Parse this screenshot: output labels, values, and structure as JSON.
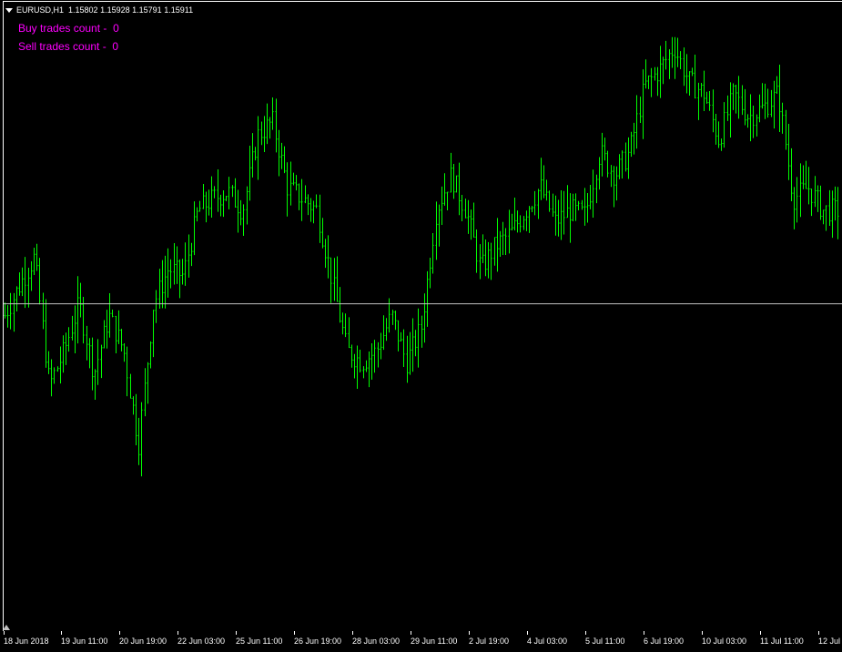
{
  "header": {
    "symbol_timeframe": "EURUSD,H1",
    "open": "1.15802",
    "high": "1.15928",
    "low": "1.15791",
    "close": "1.15911"
  },
  "stats": {
    "buy_label": "Buy trades count -",
    "buy_value": "0",
    "sell_label": "Sell trades count -",
    "sell_value": "0"
  },
  "colors": {
    "background": "#000000",
    "bars": "#00ff00",
    "text": "#ffffff",
    "stats_text": "#ff00ff",
    "grid_line": "#c0c0c0"
  },
  "time_axis": {
    "labels": [
      "18 Jun 2018",
      "19 Jun 11:00",
      "20 Jun 19:00",
      "22 Jun 03:00",
      "25 Jun 11:00",
      "26 Jun 19:00",
      "28 Jun 03:00",
      "29 Jun 11:00",
      "2 Jul 19:00",
      "4 Jul 03:00",
      "5 Jul 11:00",
      "6 Jul 19:00",
      "10 Jul 03:00",
      "11 Jul 11:00",
      "12 Jul"
    ]
  },
  "chart_data": {
    "type": "ohlc",
    "series": [
      {
        "name": "EURUSD,H1",
        "anchors": [
          {
            "t": "18 Jun 2018",
            "close": 1.1595
          },
          {
            "t": "18 Jun 2018 12:00",
            "close": 1.1608
          },
          {
            "t": "19 Jun 02:00",
            "close": 1.162
          },
          {
            "t": "19 Jun 05:00",
            "close": 1.1565
          },
          {
            "t": "19 Jun 11:00",
            "close": 1.158
          },
          {
            "t": "19 Jun 18:00",
            "close": 1.16
          },
          {
            "t": "20 Jun 04:00",
            "close": 1.157
          },
          {
            "t": "20 Jun 12:00",
            "close": 1.1595
          },
          {
            "t": "20 Jun 19:00",
            "close": 1.158
          },
          {
            "t": "21 Jun 05:00",
            "close": 1.154
          },
          {
            "t": "21 Jun 09:00",
            "close": 1.16
          },
          {
            "t": "21 Jun 14:00",
            "close": 1.1615
          },
          {
            "t": "21 Jun 22:00",
            "close": 1.1612
          },
          {
            "t": "22 Jun 03:00",
            "close": 1.164
          },
          {
            "t": "22 Jun 10:00",
            "close": 1.1645
          },
          {
            "t": "22 Jun 17:00",
            "close": 1.1648
          },
          {
            "t": "25 Jun 04:00",
            "close": 1.164
          },
          {
            "t": "25 Jun 11:00",
            "close": 1.1672
          },
          {
            "t": "25 Jun 20:00",
            "close": 1.1678
          },
          {
            "t": "26 Jun 03:00",
            "close": 1.165
          },
          {
            "t": "26 Jun 09:00",
            "close": 1.1645
          },
          {
            "t": "26 Jun 19:00",
            "close": 1.164
          },
          {
            "t": "27 Jun 04:00",
            "close": 1.161
          },
          {
            "t": "27 Jun 09:00",
            "close": 1.158
          },
          {
            "t": "27 Jun 17:00",
            "close": 1.1575
          },
          {
            "t": "28 Jun 03:00",
            "close": 1.158
          },
          {
            "t": "28 Jun 08:00",
            "close": 1.1595
          },
          {
            "t": "28 Jun 13:00",
            "close": 1.1575
          },
          {
            "t": "28 Jun 19:00",
            "close": 1.159
          },
          {
            "t": "29 Jun 02:00",
            "close": 1.164
          },
          {
            "t": "29 Jun 08:00",
            "close": 1.1655
          },
          {
            "t": "29 Jun 14:00",
            "close": 1.164
          },
          {
            "t": "2 Jul 03:00",
            "close": 1.1615
          },
          {
            "t": "2 Jul 09:00",
            "close": 1.1625
          },
          {
            "t": "2 Jul 19:00",
            "close": 1.163
          },
          {
            "t": "3 Jul 06:00",
            "close": 1.164
          },
          {
            "t": "3 Jul 16:00",
            "close": 1.165
          },
          {
            "t": "4 Jul 03:00",
            "close": 1.1635
          },
          {
            "t": "4 Jul 11:00",
            "close": 1.164
          },
          {
            "t": "4 Jul 21:00",
            "close": 1.1638
          },
          {
            "t": "5 Jul 03:00",
            "close": 1.1665
          },
          {
            "t": "5 Jul 11:00",
            "close": 1.1655
          },
          {
            "t": "5 Jul 20:00",
            "close": 1.1665
          },
          {
            "t": "6 Jul 03:00",
            "close": 1.1693
          },
          {
            "t": "6 Jul 12:00",
            "close": 1.17
          },
          {
            "t": "6 Jul 19:00",
            "close": 1.171
          },
          {
            "t": "9 Jul 03:00",
            "close": 1.1695
          },
          {
            "t": "9 Jul 12:00",
            "close": 1.169
          },
          {
            "t": "9 Jul 21:00",
            "close": 1.167
          },
          {
            "t": "10 Jul 03:00",
            "close": 1.169
          },
          {
            "t": "10 Jul 12:00",
            "close": 1.168
          },
          {
            "t": "10 Jul 20:00",
            "close": 1.1684
          },
          {
            "t": "11 Jul 05:00",
            "close": 1.169
          },
          {
            "t": "11 Jul 09:00",
            "close": 1.1645
          },
          {
            "t": "11 Jul 20:00",
            "close": 1.165
          },
          {
            "t": "12 Jul 02:00",
            "close": 1.164
          },
          {
            "t": "12 Jul 08:00",
            "close": 1.164
          }
        ]
      }
    ],
    "horizontal_line": 1.16,
    "ylim": [
      1.146,
      1.173
    ],
    "grid": false
  }
}
